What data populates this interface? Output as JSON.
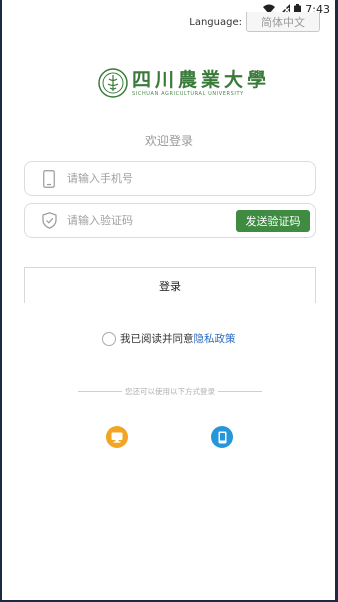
{
  "status_bar": {
    "time": "7:43",
    "icons": [
      "wifi-icon",
      "signal-icon",
      "battery-icon"
    ]
  },
  "language": {
    "label": "Language:",
    "value": "简体中文"
  },
  "logo": {
    "text_cn": "四川農業大學",
    "text_en": "SICHUAN AGRICULTURAL UNIVERSITY",
    "color": "#3a7a3a"
  },
  "welcome": "欢迎登录",
  "form": {
    "phone_placeholder": "请输入手机号",
    "code_placeholder": "请输入验证码",
    "send_code_label": "发送验证码",
    "login_label": "登录"
  },
  "agreement": {
    "text": "我已阅读并同意",
    "link": "隐私政策"
  },
  "alt_login": {
    "divider_text": "您还可以使用以下方式登录",
    "methods": [
      "pc-icon",
      "mobile-icon"
    ]
  },
  "colors": {
    "accent": "#3e8b41",
    "link": "#2b6cc4",
    "pc": "#f2a422",
    "mobile": "#2596d9"
  }
}
